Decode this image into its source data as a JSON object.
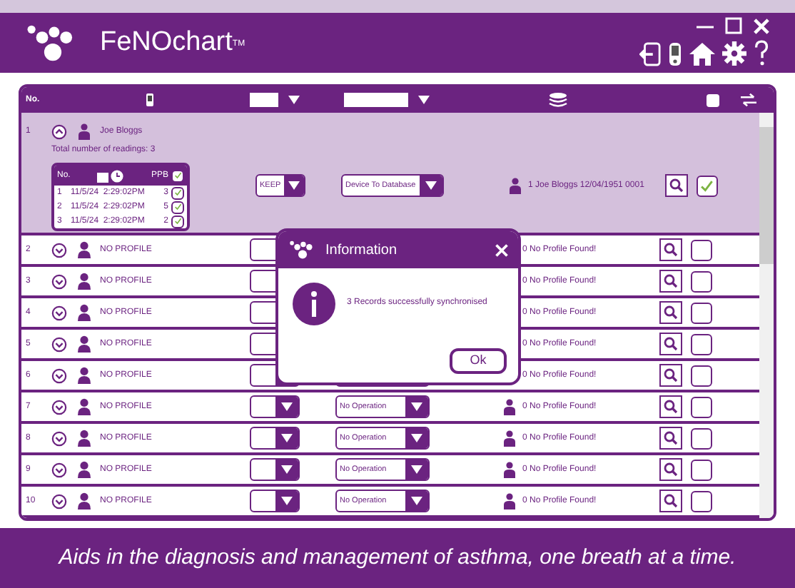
{
  "app": {
    "title": "FeNOchart",
    "trademark": "TM"
  },
  "table": {
    "header": {
      "number": "No.",
      "checked": false
    },
    "rows": [
      {
        "number": "1",
        "expanded": true,
        "name": "Joe Bloggs",
        "total": "Total number of readings: 3",
        "readings": {
          "header": {
            "number": "No.",
            "ppb": "PPB",
            "checked": true
          },
          "rows": [
            {
              "number": "1",
              "date": "11/5/24",
              "time": "2:29:02PM",
              "ppb": "3",
              "checked": true
            },
            {
              "number": "2",
              "date": "11/5/24",
              "time": "2:29:02PM",
              "ppb": "5",
              "checked": true
            },
            {
              "number": "3",
              "date": "11/5/24",
              "time": "2:29:02PM",
              "ppb": "2",
              "checked": true
            }
          ]
        },
        "action": "KEEP",
        "operation": "Device To Database",
        "profile": "1 Joe Bloggs 12/04/1951 0001",
        "checked": true
      },
      {
        "number": "2",
        "expanded": false,
        "name": "NO PROFILE",
        "profile": "0 No Profile Found!",
        "checked": false
      },
      {
        "number": "3",
        "expanded": false,
        "name": "NO PROFILE",
        "profile": "0 No Profile Found!",
        "checked": false
      },
      {
        "number": "4",
        "expanded": false,
        "name": "NO PROFILE",
        "profile": "0 No Profile Found!",
        "checked": false
      },
      {
        "number": "5",
        "expanded": false,
        "name": "NO PROFILE",
        "profile": "0 No Profile Found!",
        "checked": false
      },
      {
        "number": "6",
        "expanded": false,
        "name": "NO PROFILE",
        "profile": "0 No Profile Found!",
        "checked": false
      },
      {
        "number": "7",
        "expanded": false,
        "name": "NO PROFILE",
        "operation": "No Operation",
        "profile": "0 No Profile Found!",
        "checked": false
      },
      {
        "number": "8",
        "expanded": false,
        "name": "NO PROFILE",
        "operation": "No Operation",
        "profile": "0 No Profile Found!",
        "checked": false
      },
      {
        "number": "9",
        "expanded": false,
        "name": "NO PROFILE",
        "operation": "No Operation",
        "profile": "0 No Profile Found!",
        "checked": false
      },
      {
        "number": "10",
        "expanded": false,
        "name": "NO PROFILE",
        "operation": "No Operation",
        "profile": "0 No Profile Found!",
        "checked": false
      }
    ]
  },
  "dialog": {
    "title": "Information",
    "message": "3 Records successfully synchronised",
    "button": "Ok"
  },
  "footer": {
    "tagline": "Aids in the diagnosis and management of asthma, one breath at a time."
  }
}
